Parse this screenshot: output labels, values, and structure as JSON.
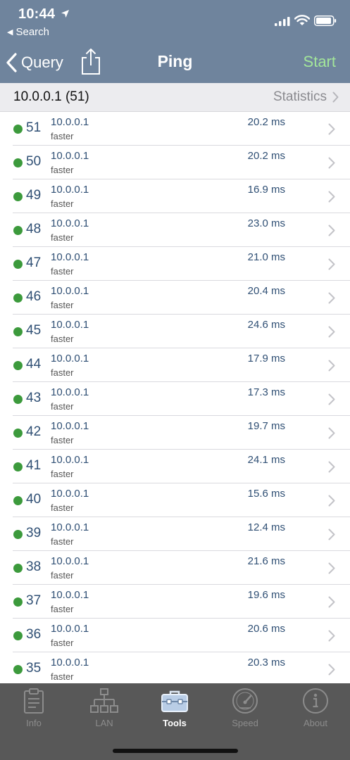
{
  "status_bar": {
    "time": "10:44",
    "back_app": "Search"
  },
  "nav": {
    "back_label": "Query",
    "title": "Ping",
    "start_label": "Start"
  },
  "section": {
    "host": "10.0.0.1 (51)",
    "stats_label": "Statistics"
  },
  "rows": [
    {
      "seq": "51",
      "host": "10.0.0.1",
      "status": "faster",
      "time": "20.2 ms"
    },
    {
      "seq": "50",
      "host": "10.0.0.1",
      "status": "faster",
      "time": "20.2 ms"
    },
    {
      "seq": "49",
      "host": "10.0.0.1",
      "status": "faster",
      "time": "16.9 ms"
    },
    {
      "seq": "48",
      "host": "10.0.0.1",
      "status": "faster",
      "time": "23.0 ms"
    },
    {
      "seq": "47",
      "host": "10.0.0.1",
      "status": "faster",
      "time": "21.0 ms"
    },
    {
      "seq": "46",
      "host": "10.0.0.1",
      "status": "faster",
      "time": "20.4 ms"
    },
    {
      "seq": "45",
      "host": "10.0.0.1",
      "status": "faster",
      "time": "24.6 ms"
    },
    {
      "seq": "44",
      "host": "10.0.0.1",
      "status": "faster",
      "time": "17.9 ms"
    },
    {
      "seq": "43",
      "host": "10.0.0.1",
      "status": "faster",
      "time": "17.3 ms"
    },
    {
      "seq": "42",
      "host": "10.0.0.1",
      "status": "faster",
      "time": "19.7 ms"
    },
    {
      "seq": "41",
      "host": "10.0.0.1",
      "status": "faster",
      "time": "24.1 ms"
    },
    {
      "seq": "40",
      "host": "10.0.0.1",
      "status": "faster",
      "time": "15.6 ms"
    },
    {
      "seq": "39",
      "host": "10.0.0.1",
      "status": "faster",
      "time": "12.4 ms"
    },
    {
      "seq": "38",
      "host": "10.0.0.1",
      "status": "faster",
      "time": "21.6 ms"
    },
    {
      "seq": "37",
      "host": "10.0.0.1",
      "status": "faster",
      "time": "19.6 ms"
    },
    {
      "seq": "36",
      "host": "10.0.0.1",
      "status": "faster",
      "time": "20.6 ms"
    },
    {
      "seq": "35",
      "host": "10.0.0.1",
      "status": "faster",
      "time": "20.3 ms"
    }
  ],
  "tabs": [
    {
      "label": "Info",
      "icon": "clipboard-icon"
    },
    {
      "label": "LAN",
      "icon": "network-tree-icon"
    },
    {
      "label": "Tools",
      "icon": "toolbox-icon"
    },
    {
      "label": "Speed",
      "icon": "speedometer-icon"
    },
    {
      "label": "About",
      "icon": "info-circle-icon"
    }
  ],
  "active_tab": "Tools",
  "colors": {
    "nav_bar": "#6f849d",
    "start_accent": "#a3e69a",
    "status_dot": "#3c9a3c",
    "row_text": "#2f4f74",
    "tab_bar": "#585858"
  }
}
